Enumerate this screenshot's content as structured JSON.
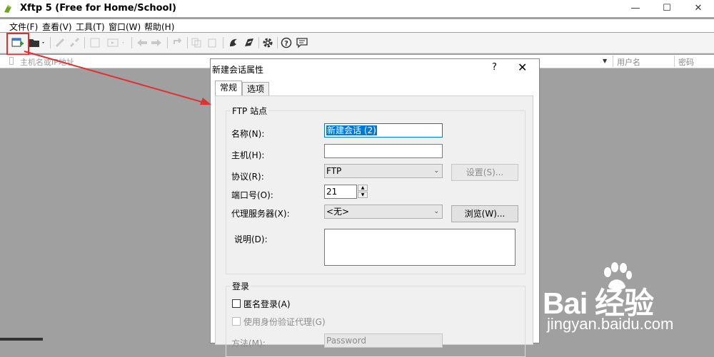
{
  "window": {
    "title": "Xftp 5 (Free for Home/School)",
    "min": "—",
    "max": "☐",
    "close": "✕"
  },
  "menu": [
    "文件(F)",
    "查看(V)",
    "工具(T)",
    "窗口(W)",
    "帮助(H)"
  ],
  "address_bar": {
    "placeholder": "主机名或IP地址",
    "col_username": "用户名",
    "col_password": "密码"
  },
  "dialog": {
    "title": "新建会话属性",
    "help": "?",
    "close": "✕",
    "tabs": [
      "常规",
      "选项"
    ],
    "active_tab": "常规",
    "ftp_group": {
      "title": "FTP 站点",
      "name_label": "名称(N):",
      "name_value": "新建会话 (2)",
      "host_label": "主机(H):",
      "host_value": "",
      "protocol_label": "协议(R):",
      "protocol_value": "FTP",
      "settings_button": "设置(S)...",
      "port_label": "端口号(O):",
      "port_value": "21",
      "proxy_label": "代理服务器(X):",
      "proxy_value": "<无>",
      "browse_button": "浏览(W)...",
      "desc_label": "说明(D):"
    },
    "login_group": {
      "title": "登录",
      "anonymous_label": "匿名登录(A)",
      "agent_label": "使用身份验证代理(G)",
      "method_label": "方法(M):",
      "method_value": "Password"
    }
  },
  "watermark": {
    "text": "Bai 经验",
    "url": "jingyan.baidu.com"
  },
  "colors": {
    "highlight": "#e03030",
    "focus": "#0078d7",
    "background": "#a0a0a0"
  }
}
